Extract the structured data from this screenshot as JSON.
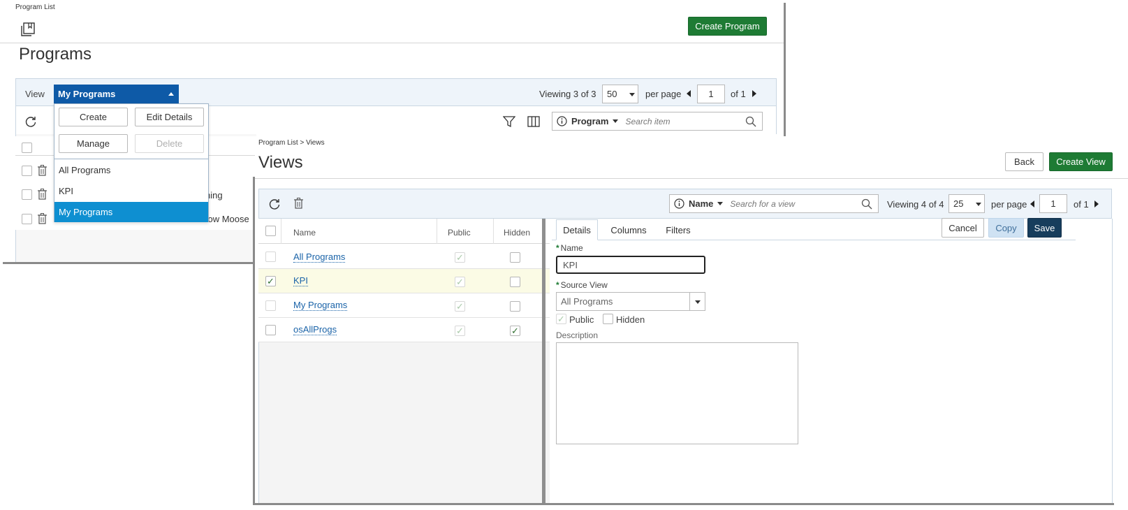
{
  "programs": {
    "breadcrumb": "Program List",
    "title": "Programs",
    "create_button": "Create Program",
    "view_label": "View",
    "view_selected": "My Programs",
    "viewing_text": "Viewing 3 of 3",
    "per_page_value": "50",
    "per_page_label": "per page",
    "page_value": "1",
    "page_total": "of 1",
    "search": {
      "field": "Program",
      "placeholder": "Search item"
    },
    "dropdown": {
      "create": "Create",
      "edit_details": "Edit Details",
      "manage": "Manage",
      "delete": "Delete",
      "items": [
        "All Programs",
        "KPI",
        "My Programs"
      ],
      "selected_index": 2
    },
    "row_fragments": {
      "row1_partial": "ning",
      "row3_partial": "Yellow Moose"
    }
  },
  "views": {
    "breadcrumb": "Program List > Views",
    "title": "Views",
    "back_button": "Back",
    "create_button": "Create View",
    "search": {
      "field": "Name",
      "placeholder": "Search for a view"
    },
    "viewing_text": "Viewing 4 of 4",
    "per_page_value": "25",
    "per_page_label": "per page",
    "page_value": "1",
    "page_total": "of 1",
    "columns": {
      "name": "Name",
      "public": "Public",
      "hidden": "Hidden"
    },
    "rows": [
      {
        "name": "All Programs",
        "checked": false,
        "public": true,
        "hidden": false
      },
      {
        "name": "KPI",
        "checked": true,
        "public": true,
        "hidden": false
      },
      {
        "name": "My Programs",
        "checked": false,
        "public": true,
        "hidden": false
      },
      {
        "name": "osAllProgs",
        "checked": false,
        "public": true,
        "hidden": true
      }
    ],
    "tabs": [
      "Details",
      "Columns",
      "Filters"
    ],
    "active_tab": "Details",
    "cancel_button": "Cancel",
    "copy_button": "Copy",
    "save_button": "Save",
    "form": {
      "name_label": "Name",
      "name_value": "KPI",
      "source_view_label": "Source View",
      "source_view_value": "All Programs",
      "public_label": "Public",
      "public_checked": true,
      "hidden_label": "Hidden",
      "hidden_checked": false,
      "description_label": "Description",
      "description_value": ""
    }
  },
  "colors": {
    "brand_green": "#1e7b34",
    "view_dropdown_blue": "#0e5aa7",
    "selected_item_blue": "#0e8fd1",
    "save_navy": "#173d5c",
    "link_blue": "#1a63a8",
    "check_green": "#3d8b3d"
  },
  "icons": [
    "program-list-icon",
    "refresh-icon",
    "filter-icon",
    "columns-icon",
    "info-icon",
    "search-icon",
    "trash-icon",
    "checkmark-icon",
    "caret-icon"
  ]
}
